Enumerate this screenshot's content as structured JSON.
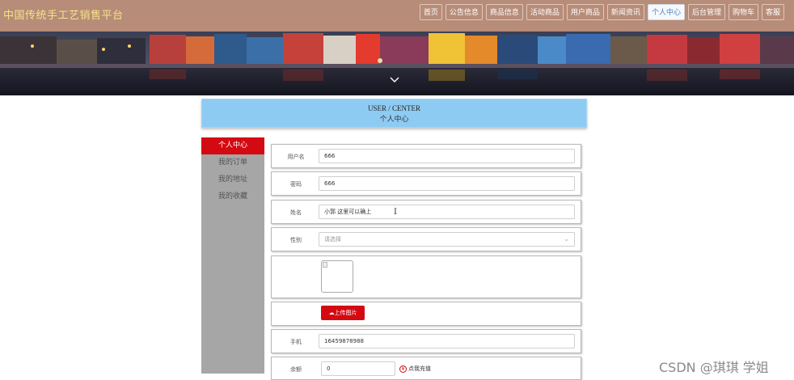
{
  "header": {
    "site_title": "中国传统手工艺销售平台",
    "nav": [
      "首页",
      "公告信息",
      "商品信息",
      "活动商品",
      "用户商品",
      "新闻资讯",
      "个人中心",
      "后台管理",
      "购物车",
      "客服"
    ],
    "active_nav": "个人中心"
  },
  "banner": {
    "icon": "chevron-down-icon"
  },
  "panel": {
    "title_en": "USER / CENTER",
    "title_cn": "个人中心"
  },
  "sidebar": {
    "items": [
      {
        "label": "个人中心"
      },
      {
        "label": "我的订单"
      },
      {
        "label": "我的地址"
      },
      {
        "label": "我的收藏"
      }
    ]
  },
  "form": {
    "username_label": "用户名",
    "username_value": "666",
    "password_label": "密码",
    "password_value": "666",
    "name_label": "姓名",
    "name_value": "小郭 这里可以确上",
    "gender_label": "性别",
    "gender_placeholder": "请选择",
    "upload_label": "上传图片",
    "phone_label": "手机",
    "phone_value": "16459878988",
    "balance_label": "余额",
    "balance_value": "0",
    "recharge_label": "点我充值"
  },
  "watermark": "CSDN @琪琪 学姐",
  "colors": {
    "topbar": "#b78c78",
    "accent_red": "#d40a12",
    "panel_blue": "#8ecbf3",
    "sidebar_gray": "#a6a6a6"
  }
}
